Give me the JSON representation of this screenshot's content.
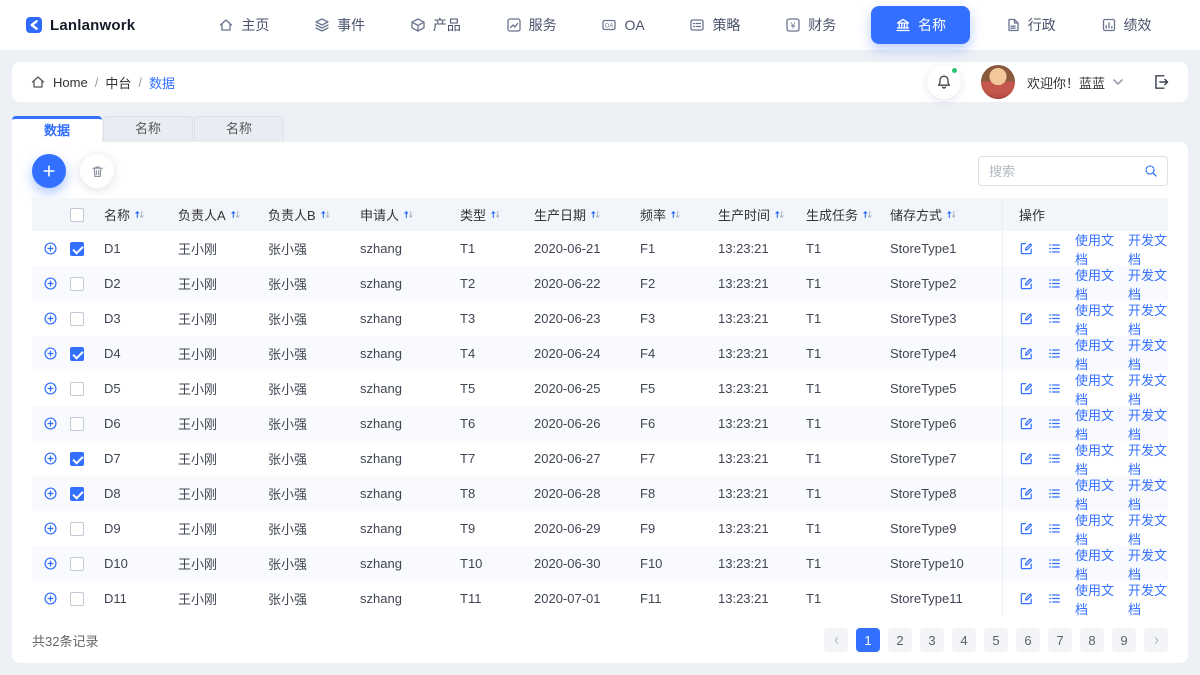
{
  "brand": {
    "name": "Lanlanwork"
  },
  "nav": {
    "items": [
      {
        "id": "home",
        "icon": "home",
        "label": "主页",
        "active": false
      },
      {
        "id": "events",
        "icon": "layers",
        "label": "事件",
        "active": false
      },
      {
        "id": "products",
        "icon": "cube",
        "label": "产品",
        "active": false
      },
      {
        "id": "services",
        "icon": "chart",
        "label": "服务",
        "active": false
      },
      {
        "id": "oa",
        "icon": "oa",
        "label": "OA",
        "active": false
      },
      {
        "id": "strategy",
        "icon": "strategy",
        "label": "策略",
        "active": false
      },
      {
        "id": "finance",
        "icon": "yen",
        "label": "财务",
        "active": false
      },
      {
        "id": "names",
        "icon": "bank",
        "label": "名称",
        "active": true
      },
      {
        "id": "admin",
        "icon": "admindoc",
        "label": "行政",
        "active": false
      },
      {
        "id": "performance",
        "icon": "perf",
        "label": "绩效",
        "active": false
      }
    ]
  },
  "breadcrumb": {
    "home": "Home",
    "section": "中台",
    "page": "数据"
  },
  "user": {
    "welcome": "欢迎你！蓝蓝"
  },
  "tabs": [
    {
      "label": "数据",
      "active": true
    },
    {
      "label": "名称",
      "active": false
    },
    {
      "label": "名称",
      "active": false
    }
  ],
  "search": {
    "placeholder": "搜索"
  },
  "table": {
    "columns": [
      "名称",
      "负责人A",
      "负责人B",
      "申请人",
      "类型",
      "生产日期",
      "频率",
      "生产时间",
      "生成任务",
      "储存方式"
    ],
    "ops_header": "操作",
    "op_links": [
      "使用文档",
      "开发文档"
    ],
    "rows": [
      {
        "checked": true,
        "name": "D1",
        "owner_a": "王小刚",
        "owner_b": "张小强",
        "applicant": "szhang",
        "type": "T1",
        "date": "2020-06-21",
        "freq": "F1",
        "time": "13:23:21",
        "task": "T1",
        "storage": "StoreType1"
      },
      {
        "checked": false,
        "name": "D2",
        "owner_a": "王小刚",
        "owner_b": "张小强",
        "applicant": "szhang",
        "type": "T2",
        "date": "2020-06-22",
        "freq": "F2",
        "time": "13:23:21",
        "task": "T1",
        "storage": "StoreType2"
      },
      {
        "checked": false,
        "name": "D3",
        "owner_a": "王小刚",
        "owner_b": "张小强",
        "applicant": "szhang",
        "type": "T3",
        "date": "2020-06-23",
        "freq": "F3",
        "time": "13:23:21",
        "task": "T1",
        "storage": "StoreType3"
      },
      {
        "checked": true,
        "name": "D4",
        "owner_a": "王小刚",
        "owner_b": "张小强",
        "applicant": "szhang",
        "type": "T4",
        "date": "2020-06-24",
        "freq": "F4",
        "time": "13:23:21",
        "task": "T1",
        "storage": "StoreType4"
      },
      {
        "checked": false,
        "name": "D5",
        "owner_a": "王小刚",
        "owner_b": "张小强",
        "applicant": "szhang",
        "type": "T5",
        "date": "2020-06-25",
        "freq": "F5",
        "time": "13:23:21",
        "task": "T1",
        "storage": "StoreType5"
      },
      {
        "checked": false,
        "name": "D6",
        "owner_a": "王小刚",
        "owner_b": "张小强",
        "applicant": "szhang",
        "type": "T6",
        "date": "2020-06-26",
        "freq": "F6",
        "time": "13:23:21",
        "task": "T1",
        "storage": "StoreType6"
      },
      {
        "checked": true,
        "name": "D7",
        "owner_a": "王小刚",
        "owner_b": "张小强",
        "applicant": "szhang",
        "type": "T7",
        "date": "2020-06-27",
        "freq": "F7",
        "time": "13:23:21",
        "task": "T1",
        "storage": "StoreType7"
      },
      {
        "checked": true,
        "name": "D8",
        "owner_a": "王小刚",
        "owner_b": "张小强",
        "applicant": "szhang",
        "type": "T8",
        "date": "2020-06-28",
        "freq": "F8",
        "time": "13:23:21",
        "task": "T1",
        "storage": "StoreType8"
      },
      {
        "checked": false,
        "name": "D9",
        "owner_a": "王小刚",
        "owner_b": "张小强",
        "applicant": "szhang",
        "type": "T9",
        "date": "2020-06-29",
        "freq": "F9",
        "time": "13:23:21",
        "task": "T1",
        "storage": "StoreType9"
      },
      {
        "checked": false,
        "name": "D10",
        "owner_a": "王小刚",
        "owner_b": "张小强",
        "applicant": "szhang",
        "type": "T10",
        "date": "2020-06-30",
        "freq": "F10",
        "time": "13:23:21",
        "task": "T1",
        "storage": "StoreType10"
      },
      {
        "checked": false,
        "name": "D11",
        "owner_a": "王小刚",
        "owner_b": "张小强",
        "applicant": "szhang",
        "type": "T11",
        "date": "2020-07-01",
        "freq": "F11",
        "time": "13:23:21",
        "task": "T1",
        "storage": "StoreType11"
      }
    ]
  },
  "footer": {
    "total": "共32条记录",
    "pages": [
      "1",
      "2",
      "3",
      "4",
      "5",
      "6",
      "7",
      "8",
      "9"
    ],
    "active_page": "1"
  },
  "colors": {
    "primary": "#3370ff",
    "notification": "#2bc26f"
  }
}
